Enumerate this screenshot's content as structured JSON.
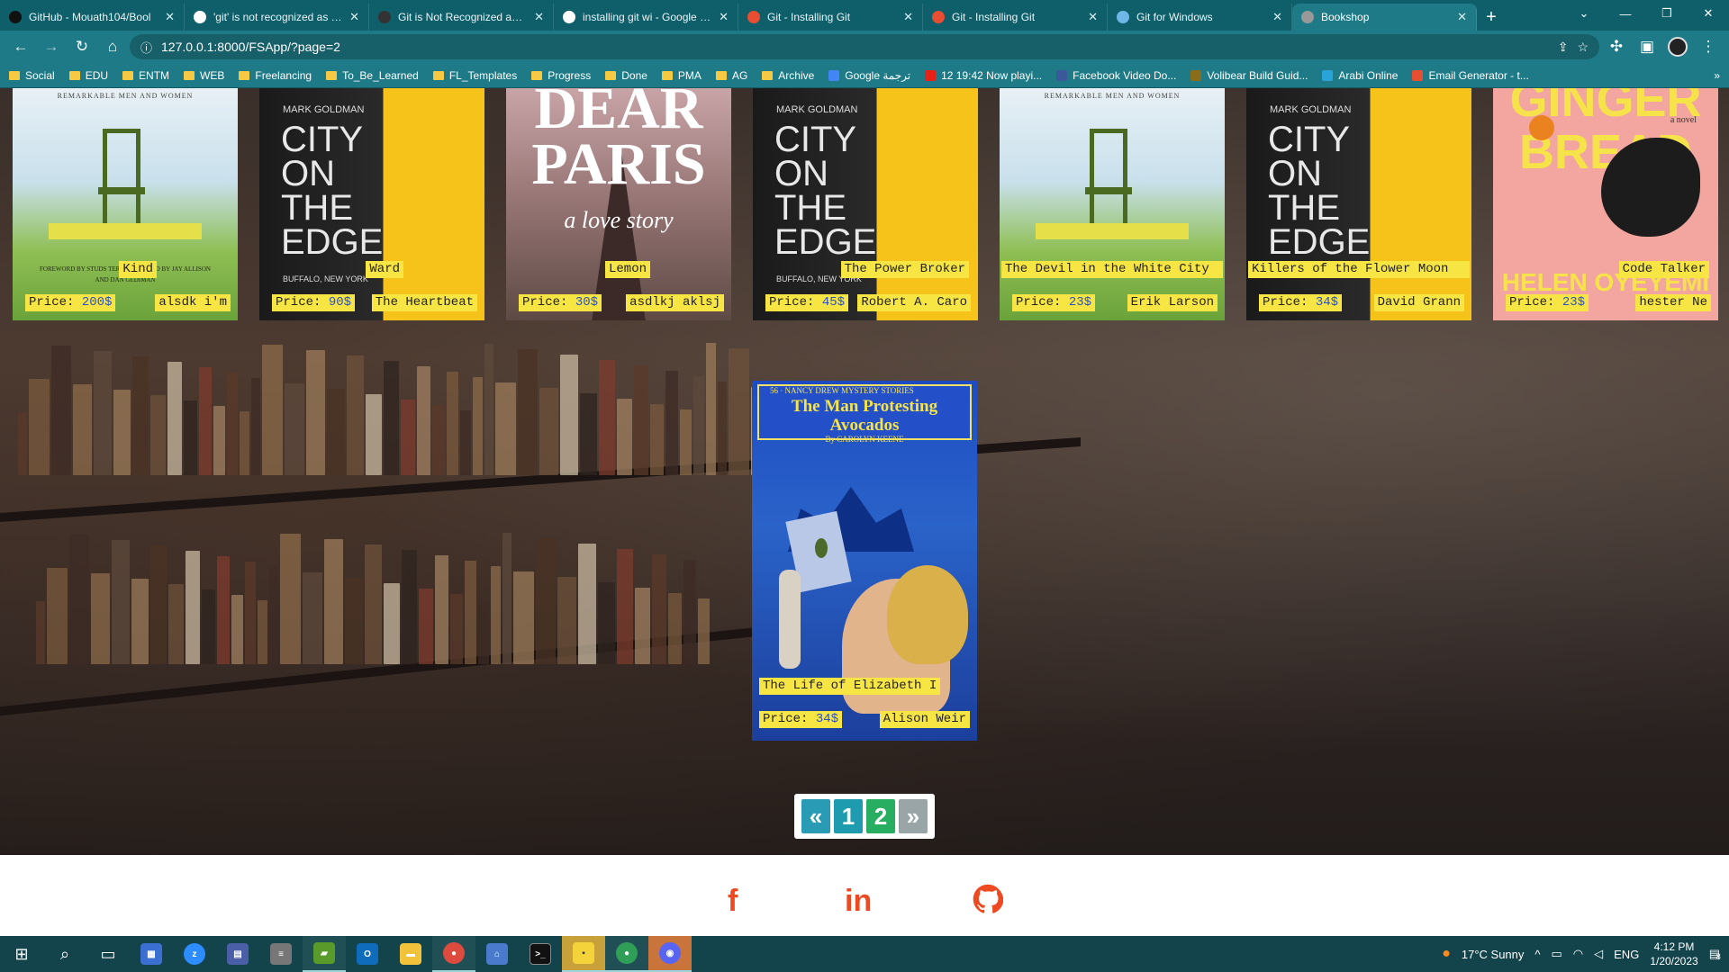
{
  "tabs": [
    {
      "title": "GitHub - Mouath104/Bool",
      "fav": "github-icon",
      "color": "#111"
    },
    {
      "title": "'git' is not recognized as an",
      "fav": "google-icon",
      "color": "#fff"
    },
    {
      "title": "Git is Not Recognized as an",
      "fav": "site-icon",
      "color": "#333"
    },
    {
      "title": "installing git wi - Google Se",
      "fav": "google-icon",
      "color": "#fff"
    },
    {
      "title": "Git - Installing Git",
      "fav": "git-icon",
      "color": "#e84e31"
    },
    {
      "title": "Git - Installing Git",
      "fav": "git-icon",
      "color": "#e84e31"
    },
    {
      "title": "Git for Windows",
      "fav": "git-windows-icon",
      "color": "#6fb7e9"
    },
    {
      "title": "Bookshop",
      "fav": "bookshop-icon",
      "color": "#999"
    }
  ],
  "address": {
    "url": "127.0.0.1:8000/FSApp/?page=2"
  },
  "bookmarks": [
    {
      "label": "Social",
      "type": "folder"
    },
    {
      "label": "EDU",
      "type": "folder"
    },
    {
      "label": "ENTM",
      "type": "folder"
    },
    {
      "label": "WEB",
      "type": "folder"
    },
    {
      "label": "Freelancing",
      "type": "folder"
    },
    {
      "label": "To_Be_Learned",
      "type": "folder"
    },
    {
      "label": "FL_Templates",
      "type": "folder"
    },
    {
      "label": "Progress",
      "type": "folder"
    },
    {
      "label": "Done",
      "type": "folder"
    },
    {
      "label": "PMA",
      "type": "folder"
    },
    {
      "label": "AG",
      "type": "folder"
    },
    {
      "label": "Archive",
      "type": "folder"
    },
    {
      "label": "Google ترجمة",
      "type": "link"
    },
    {
      "label": "12 19:42 Now playi...",
      "type": "link"
    },
    {
      "label": "Facebook Video Do...",
      "type": "link"
    },
    {
      "label": "Volibear Build Guid...",
      "type": "link"
    },
    {
      "label": "Arabi Online",
      "type": "link"
    },
    {
      "label": "Email Generator - t...",
      "type": "link"
    }
  ],
  "books_top": [
    {
      "title": "Kind",
      "price_label": "Price:",
      "price": "200$",
      "author": "alsdk i'm",
      "cover": "chair",
      "cover_top": "REMARKABLE MEN AND WOMEN",
      "cover_bottom": "FOREWORD BY STUDS TERKEL · EDITED BY JAY ALLISON AND DAN GEDIMAN"
    },
    {
      "title": "Ward",
      "price_label": "Price:",
      "price": "90$",
      "author": "The Heartbeat",
      "cover": "city",
      "cover_top": "MARK GOLDMAN",
      "cover_main": "CITY ON THE EDGE",
      "cover_bottom": "BUFFALO, NEW YORK"
    },
    {
      "title": "Lemon",
      "price_label": "Price:",
      "price": "30$",
      "author": "asdlkj aklsj",
      "cover": "paris",
      "cover_main": "DEAR PARIS",
      "cover_sub": "a love story"
    },
    {
      "title": "The Power Broker",
      "price_label": "Price:",
      "price": "45$",
      "author": "Robert A. Caro",
      "cover": "city",
      "cover_top": "MARK GOLDMAN",
      "cover_main": "CITY ON THE EDGE",
      "cover_bottom": "BUFFALO, NEW YORK"
    },
    {
      "title": "The Devil in the White City",
      "price_label": "Price:",
      "price": "23$",
      "author": "Erik Larson",
      "cover": "chair",
      "cover_top": "REMARKABLE MEN AND WOMEN",
      "cover_bottom": ""
    },
    {
      "title": "Killers of the Flower Moon",
      "price_label": "Price:",
      "price": "34$",
      "author": "David Grann",
      "cover": "city",
      "cover_top": "MARK GOLDMAN",
      "cover_main": "CITY ON THE EDGE",
      "cover_bottom": ""
    },
    {
      "title": "Code Talker",
      "price_label": "Price:",
      "price": "23$",
      "author": "hester Ne",
      "cover": "ginger",
      "cover_main": "GINGER BREAD",
      "cover_sub": "a novel",
      "cover_bottom": "HELEN OYEYEMI"
    }
  ],
  "book_featured": {
    "title": "The Life of Elizabeth I",
    "price_label": "Price:",
    "price": "34$",
    "author": "Alison Weir",
    "cover_top": "56 · NANCY DREW MYSTERY STORIES",
    "cover_main": "The Man Protesting Avocados",
    "cover_sub": "By CAROLYN KEENE"
  },
  "pagination": {
    "prev": "«",
    "pages": [
      "1",
      "2"
    ],
    "next": "»",
    "current": "2",
    "colors": {
      "nav": "#2a9bb5",
      "page1": "#1f9bb0",
      "page2": "#27ae60",
      "next": "#9aa5a8"
    }
  },
  "footer": {
    "facebook": "f",
    "linkedin": "in",
    "github": "github-icon"
  },
  "taskbar": {
    "weather": "17°C  Sunny",
    "lang": "ENG",
    "time": "4:12 PM",
    "date": "1/20/2023",
    "notif": "8"
  }
}
